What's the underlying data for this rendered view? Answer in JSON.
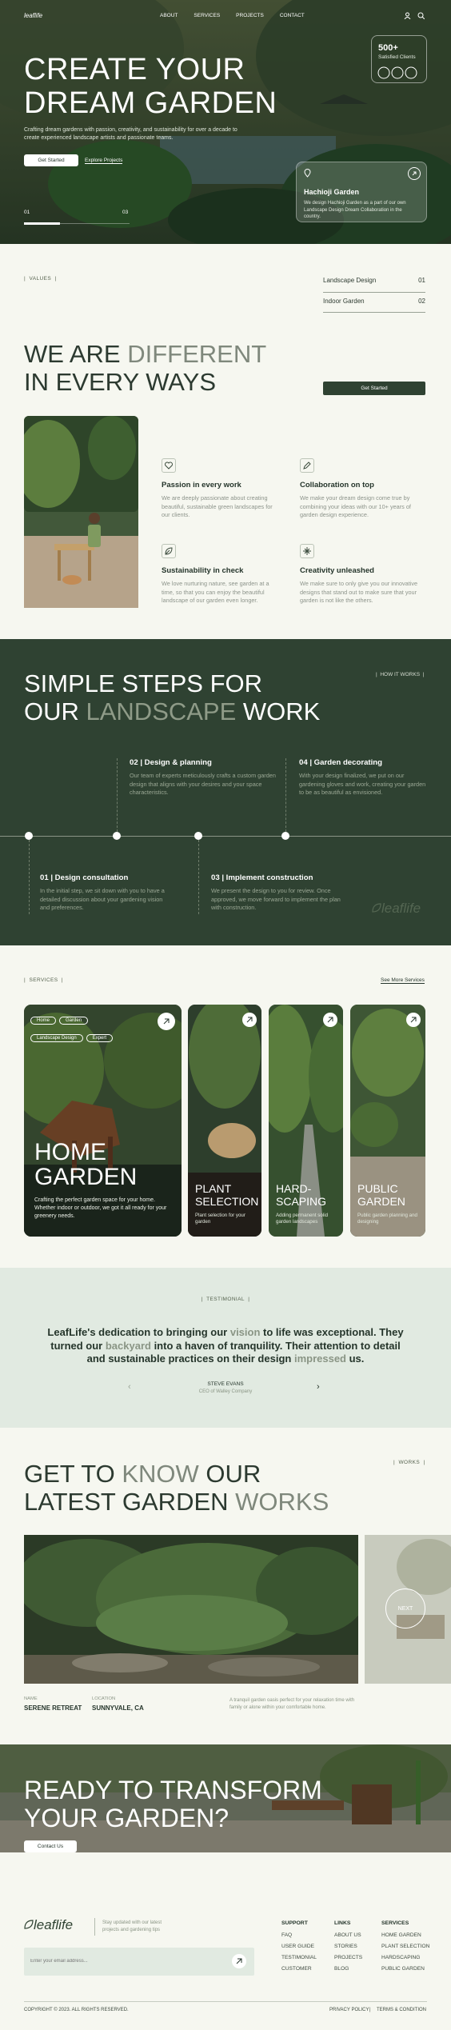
{
  "nav": {
    "logo": "leaflife",
    "links": [
      "ABOUT",
      "SERVICES",
      "PROJECTS",
      "CONTACT"
    ]
  },
  "hero": {
    "title_1": "CREATE YOUR",
    "title_2": "DREAM GARDEN",
    "subtitle": "Crafting dream gardens with passion, creativity, and sustainability for over a decade to create experienced landscape artists and passionate teams.",
    "btn_start": "Get Started",
    "btn_explore": "Explore Projects",
    "stat_value": "500+",
    "stat_label": "Satisfied Clients",
    "slide_from": "01",
    "slide_to": "03",
    "card_title": "Hachioji Garden",
    "card_desc": "We design Hachioji Garden as a part of our own Landscape Design Dream Collaboration in the country."
  },
  "values": {
    "tag": "VALUES",
    "rows": [
      {
        "label": "Landscape Design",
        "num": "01"
      },
      {
        "label": "Indoor Garden",
        "num": "02"
      }
    ],
    "head_1a": "WE ARE ",
    "head_1b": "DIFFERENT",
    "head_2": "IN EVERY WAYS",
    "btn": "Get Started",
    "features": [
      {
        "title": "Passion in every work",
        "desc": "We are deeply passionate about creating beautiful, sustainable green landscapes for our clients.",
        "icon": "heart-icon"
      },
      {
        "title": "Collaboration on top",
        "desc": "We make your dream design come true by combining your ideas with our 10+ years of garden design experience.",
        "icon": "edit-icon"
      },
      {
        "title": "Sustainability in check",
        "desc": "We love nurturing nature, see garden at a time, so that you can enjoy the beautiful landscape of our garden even longer.",
        "icon": "leaf-icon"
      },
      {
        "title": "Creativity unleashed",
        "desc": "We make sure to only give you our innovative designs that stand out to make sure that your garden is not like the others.",
        "icon": "spark-icon"
      }
    ]
  },
  "steps": {
    "tag": "HOW IT WORKS",
    "head_1": "SIMPLE STEPS FOR",
    "head_2a": "OUR ",
    "head_2b": "LANDSCAPE",
    "head_2c": " WORK",
    "watermark": "leaflife",
    "items": [
      {
        "title": "01 | Design consultation",
        "desc": "In the initial step, we sit down with you to have a detailed discussion about your gardening vision and preferences."
      },
      {
        "title": "02 | Design & planning",
        "desc": "Our team of experts meticulously crafts a custom garden design that aligns with your desires and your space characteristics."
      },
      {
        "title": "03 | Implement construction",
        "desc": "We present the design to you for review. Once approved, we move forward to implement the plan with construction."
      },
      {
        "title": "04 | Garden decorating",
        "desc": "With your design finalized, we put on our gardening gloves and work, creating your garden to be as beautiful as envisioned."
      }
    ]
  },
  "services": {
    "tag": "SERVICES",
    "more": "See More Services",
    "tags": [
      "Home",
      "Garden",
      "Landscape Design",
      "Expert"
    ],
    "main_title_1": "HOME",
    "main_title_2": "GARDEN",
    "main_desc": "Crafting the perfect garden space for your home. Whether indoor or outdoor, we got it all ready for your greenery needs.",
    "cards": [
      {
        "t1": "PLANT",
        "t2": "SELECTION",
        "d": "Plant selection for your garden"
      },
      {
        "t1": "HARD-",
        "t2": "SCAPING",
        "d": "Adding permanent solid garden landscapes"
      },
      {
        "t1": "PUBLIC",
        "t2": "GARDEN",
        "d": "Public garden planning and designing"
      }
    ]
  },
  "testimonial": {
    "tag": "TESTIMONIAL",
    "q1a": "LeafLife's dedication to bringing our ",
    "q1b": "vision",
    "q1c": " to life was exceptional. They",
    "q2a": "turned our ",
    "q2b": "backyard",
    "q2c": " into a haven of tranquility. Their attention to detail",
    "q3a": "and sustainable practices on their design ",
    "q3b": "impressed",
    "q3c": " us.",
    "name": "STEVE EVANS",
    "role": "CEO of Walley Company"
  },
  "works": {
    "tag": "WORKS",
    "head_1a": "GET TO ",
    "head_1b": "KNOW",
    "head_1c": " OUR",
    "head_2a": "LATEST GARDEN ",
    "head_2b": "WORKS",
    "next": "NEXT",
    "name_lbl": "NAME",
    "name": "SERENE RETREAT",
    "loc_lbl": "LOCATION",
    "loc": "SUNNYVALE, CA",
    "desc": "A tranquil garden oasis perfect for your relaxation time with family or alone within your comfortable home."
  },
  "cta": {
    "head_1": "READY TO TRANSFORM",
    "head_2": "YOUR GARDEN?",
    "btn": "Contact Us"
  },
  "footer": {
    "logo": "leaflife",
    "tagline": "Stay updated with our latest projects and gardening tips",
    "email_placeholder": "Enter your email address...",
    "support": {
      "title": "SUPPORT",
      "items": [
        "FAQ",
        "USER GUIDE",
        "TESTIMONIAL",
        "CUSTOMER"
      ]
    },
    "links": {
      "title": "LINKS",
      "items": [
        "ABOUT US",
        "STORIES",
        "PROJECTS",
        "BLOG"
      ]
    },
    "services": {
      "title": "SERVICES",
      "items": [
        "HOME GARDEN",
        "PLANT SELECTION",
        "HARDSCAPING",
        "PUBLIC GARDEN"
      ]
    },
    "copyright": "COPYRIGHT © 2023. ALL RIGHTS RESERVED.",
    "privacy": "PRIVACY POLICY",
    "terms": "TERMS & CONDITION"
  },
  "colors": {
    "dark": "#2f4232",
    "cream": "#f6f7f0",
    "mint": "#e1eae1",
    "muted": "#7e887c"
  }
}
